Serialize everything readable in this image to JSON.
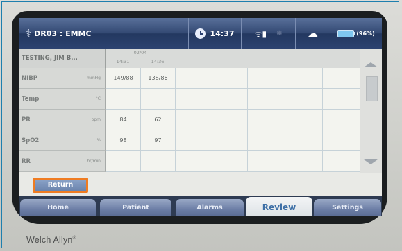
{
  "brand": "Welch Allyn",
  "status_bar": {
    "device_name": "DR03 : EMMC",
    "time": "14:37",
    "battery": "(96%)",
    "icons": [
      "caduceus-icon",
      "clock-icon",
      "wifi-signal-icon",
      "bluetooth-icon",
      "user-network-icon",
      "battery-icon"
    ]
  },
  "review_table": {
    "patient_name": "TESTING, JIM B...",
    "date": "02/04",
    "times": [
      "14:31",
      "14:36"
    ],
    "rows": [
      {
        "name": "NIBP",
        "unit": "mmHg",
        "values": [
          "149/88",
          "138/86"
        ]
      },
      {
        "name": "Temp",
        "unit": "°C",
        "values": [
          "",
          ""
        ]
      },
      {
        "name": "PR",
        "unit": "bpm",
        "values": [
          "84",
          "62"
        ]
      },
      {
        "name": "SpO2",
        "unit": "%",
        "values": [
          "98",
          "97"
        ]
      },
      {
        "name": "RR",
        "unit": "br/min",
        "values": [
          "",
          ""
        ]
      }
    ]
  },
  "return_label": "Return",
  "tabs": [
    {
      "label": "Home",
      "active": false
    },
    {
      "label": "Patient",
      "active": false
    },
    {
      "label": "Alarms",
      "active": false
    },
    {
      "label": "Review",
      "active": true
    },
    {
      "label": "Settings",
      "active": false
    }
  ],
  "colors": {
    "accent": "#ef7c22",
    "header": "#344a74",
    "active_tab_text": "#3d6fa6"
  }
}
